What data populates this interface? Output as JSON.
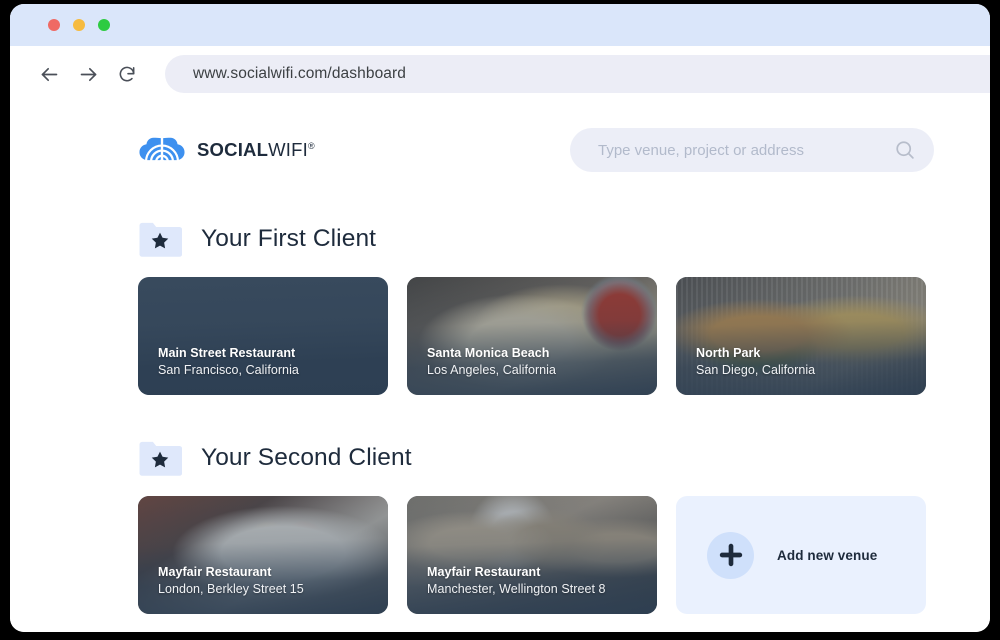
{
  "window": {
    "traffic_lights": [
      {
        "name": "close",
        "color": "#ef6a64"
      },
      {
        "name": "minimize",
        "color": "#f6bb3f"
      },
      {
        "name": "maximize",
        "color": "#2ecb42"
      }
    ]
  },
  "toolbar": {
    "back_icon": "arrow-left-icon",
    "forward_icon": "arrow-right-icon",
    "reload_icon": "reload-icon",
    "url": "www.socialwifi.com/dashboard"
  },
  "brand": {
    "logo_icon": "socialwifi-cloud-logo-icon",
    "name_bold": "SOCIAL",
    "name_light": "WIFI",
    "registered_mark": "®",
    "color": "#3d90ef"
  },
  "search": {
    "placeholder": "Type venue, project or address",
    "value": "",
    "icon": "search-icon"
  },
  "sections": [
    {
      "icon": "folder-star-icon",
      "title": "Your First Client",
      "venues": [
        {
          "name": "Main Street Restaurant",
          "location": "San Francisco, California",
          "photo": "fries-with-dip"
        },
        {
          "name": "Santa Monica Beach",
          "location": "Los Angeles, California",
          "photo": "loaded-fries-with-ketchup"
        },
        {
          "name": "North Park",
          "location": "San Diego, California",
          "photo": "burger-and-fries-basket"
        }
      ],
      "has_add_card": false
    },
    {
      "icon": "folder-star-icon",
      "title": "Your Second Client",
      "venues": [
        {
          "name": "Mayfair Restaurant",
          "location": "London, Berkley Street 15",
          "photo": "bruschetta-plate"
        },
        {
          "name": "Mayfair Restaurant",
          "location": "Manchester, Wellington Street 8",
          "photo": "chef-plating-dishes"
        }
      ],
      "has_add_card": true
    }
  ],
  "add_venue": {
    "label": "Add new venue",
    "icon": "plus-icon",
    "background": "#eaf1fe",
    "circle_color": "#cfe0fb"
  },
  "colors": {
    "titlebar": "#dae6fa",
    "urlbar": "#ecedf6",
    "search_bg": "#eceef7",
    "text_dark": "#1e2b3c",
    "accent_blue": "#3d90ef"
  }
}
